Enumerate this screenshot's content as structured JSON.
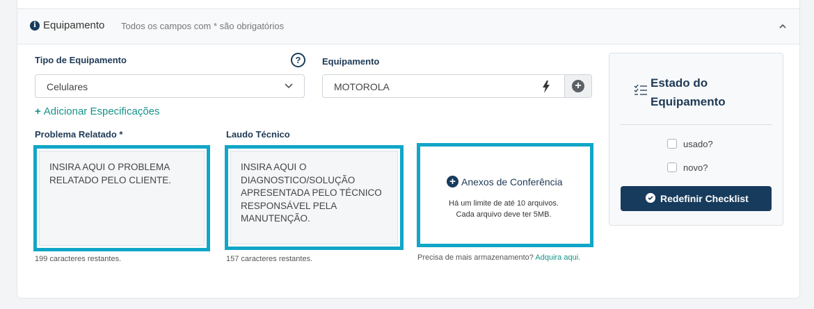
{
  "section": {
    "title": "Equipamento",
    "subtitle": "Todos os campos com * são obrigatórios"
  },
  "tipo": {
    "label": "Tipo de Equipamento",
    "value": "Celulares",
    "help": "?"
  },
  "equipamento": {
    "label": "Equipamento",
    "value": "MOTOROLA"
  },
  "add_spec_label": "Adicionar Especificações",
  "problema": {
    "label": "Problema Relatado *",
    "placeholder": "INSIRA AQUI O PROBLEMA\nRELATADO PELO CLIENTE.",
    "counter": "199 caracteres restantes."
  },
  "laudo": {
    "label": "Laudo Técnico",
    "placeholder": "INSIRA AQUI O\nDIAGNOSTICO/SOLUÇÃO\nAPRESENTADA PELO TÉCNICO\nRESPONSÁVEL PELA\nMANUTENÇÃO.",
    "counter": "157 caracteres restantes."
  },
  "anexos": {
    "title": "Anexos de Conferência",
    "limit_line1": "Há um limite de até 10 arquivos.",
    "limit_line2": "Cada arquivo deve ter 5MB.",
    "storage_text": "Precisa de mais armazenamento?",
    "storage_link": "Adquira aqui."
  },
  "estado": {
    "title": "Estado do Equipamento",
    "options": [
      {
        "label": "usado?",
        "checked": false
      },
      {
        "label": "novo?",
        "checked": false
      }
    ],
    "reset_label": "Redefinir Checklist"
  },
  "colors": {
    "accent_teal": "#17928a",
    "highlight_border": "#11a6c8",
    "primary_navy": "#173b5c"
  },
  "icons": [
    "info-icon",
    "chevron-up-icon",
    "help-icon",
    "chevron-down-icon",
    "bolt-icon",
    "plus-circle-icon",
    "checklist-icon",
    "check-circle-icon"
  ]
}
